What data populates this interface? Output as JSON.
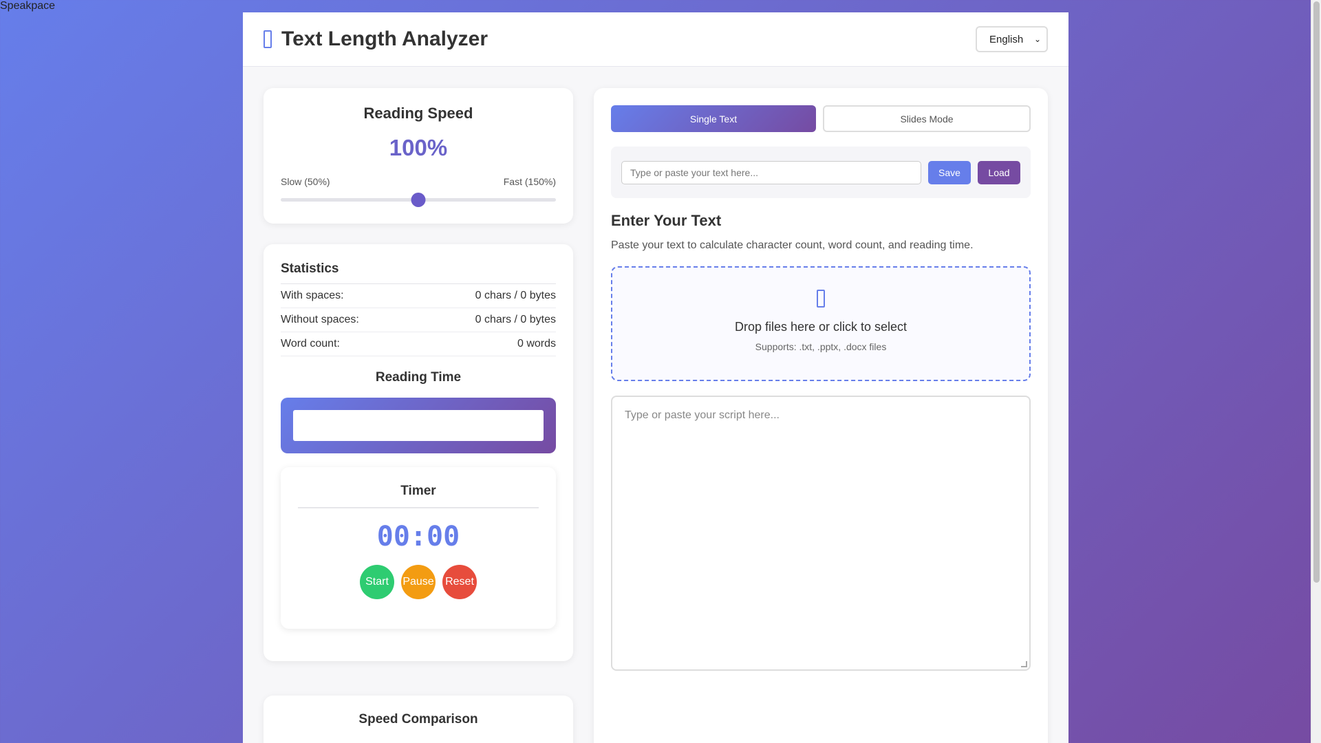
{
  "site": {
    "label": "Speakpace"
  },
  "header": {
    "logo_icon": "document-icon",
    "title": "Text Length Analyzer",
    "language": "English"
  },
  "speed": {
    "title": "Reading Speed",
    "value": "100%",
    "min_label": "Slow (50%)",
    "max_label": "Fast (150%)",
    "slider_fraction": 0.5
  },
  "stats": {
    "title": "Statistics",
    "rows": [
      {
        "label": "With spaces:",
        "value": "0 chars / 0 bytes"
      },
      {
        "label": "Without spaces:",
        "value": "0 chars / 0 bytes"
      },
      {
        "label": "Word count:",
        "value": "0 words"
      }
    ],
    "reading_time_title": "Reading Time"
  },
  "timer": {
    "title": "Timer",
    "display": "00:00",
    "start": "Start",
    "pause": "Pause",
    "reset": "Reset"
  },
  "comparison": {
    "title": "Speed Comparison"
  },
  "modes": {
    "single": "Single Text",
    "slides": "Slides Mode"
  },
  "save_bar": {
    "placeholder": "Type or paste your text here...",
    "save": "Save",
    "load": "Load"
  },
  "editor": {
    "title": "Enter Your Text",
    "description": "Paste your text to calculate character count, word count, and reading time.",
    "drop_icon": "file-icon",
    "drop_text": "Drop files here or click to select",
    "drop_sub": "Supports: .txt, .pptx, .docx files",
    "script_placeholder": "Type or paste your script here..."
  },
  "colors": {
    "accent": "#667eea",
    "accent2": "#764ba2",
    "start": "#2ecc71",
    "pause": "#f39c12",
    "reset": "#e74c3c"
  }
}
